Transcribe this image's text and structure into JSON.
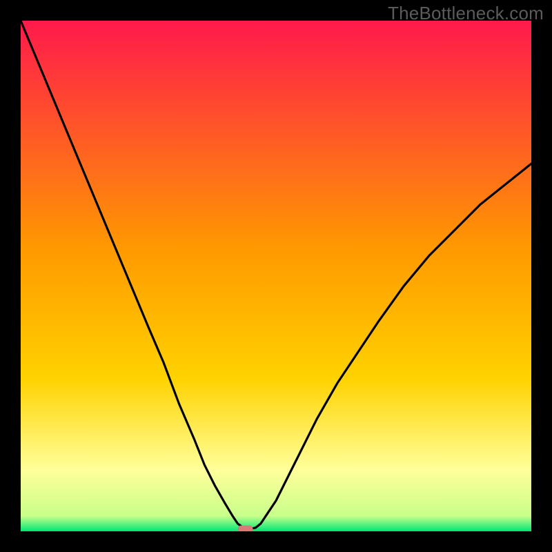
{
  "watermark": "TheBottleneck.com",
  "chart_data": {
    "type": "line",
    "title": "",
    "xlabel": "",
    "ylabel": "",
    "xlim": [
      0,
      100
    ],
    "ylim": [
      0,
      100
    ],
    "grid": false,
    "legend": false,
    "background_gradient": {
      "top_color": "#ff1a4b",
      "mid_color": "#ffd200",
      "lower_band_color": "#ffff9a",
      "bottom_color": "#00e676"
    },
    "series": [
      {
        "name": "bottleneck-curve",
        "color": "#000000",
        "x": [
          0,
          5,
          10,
          15,
          20,
          25,
          28,
          31,
          34,
          36,
          38,
          40,
          41.5,
          42.5,
          43.5,
          45,
          46,
          47,
          48,
          50,
          52,
          55,
          58,
          62,
          66,
          70,
          75,
          80,
          85,
          90,
          95,
          100
        ],
        "values": [
          100,
          88,
          76,
          64,
          52,
          40,
          33,
          25,
          18,
          13,
          9,
          5.5,
          3,
          1.5,
          0.8,
          0.5,
          0.7,
          1.5,
          3,
          6,
          10,
          16,
          22,
          29,
          35,
          41,
          48,
          54,
          59,
          64,
          68,
          72
        ]
      }
    ],
    "marker": {
      "name": "optimal-point",
      "x": 44,
      "y": 0.4,
      "color": "#d97a7a",
      "shape": "rounded-rect"
    }
  }
}
